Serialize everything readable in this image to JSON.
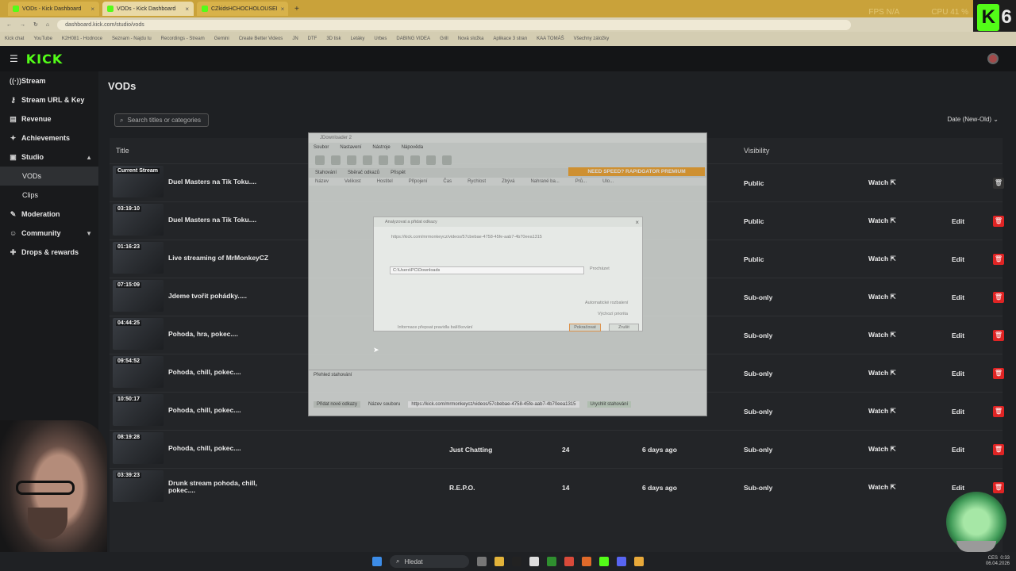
{
  "browser": {
    "tabs": [
      {
        "label": "VODs - Kick Dashboard"
      },
      {
        "label": "VODs - Kick Dashboard"
      },
      {
        "label": "CZkidsHCHOCHOLOUSEI"
      }
    ],
    "new_tab": "+",
    "url": "dashboard.kick.com/studio/vods",
    "hud": {
      "fps": "FPS N/A",
      "cpu": "CPU 41 %"
    },
    "overlay_number": "6",
    "bookmarks": [
      "Kick chat",
      "YouTube",
      "K2H081 - Hodnoce",
      "Seznam - Najdu tu",
      "Recordings - Stream",
      "Gemini",
      "Create Better Videos",
      "JN",
      "DTF",
      "3D tisk",
      "Letáky",
      "Urbes",
      "DABING VIDEA",
      "Grill",
      "Nová složka",
      "Aplikace 3 stran",
      "KAA TOMÁŠ",
      "Všechny záložky"
    ]
  },
  "app": {
    "logo": "KICK",
    "nav": [
      {
        "icon": "stream-icon",
        "glyph": "((·))",
        "label": "Stream"
      },
      {
        "icon": "key-icon",
        "glyph": "⚷",
        "label": "Stream URL & Key"
      },
      {
        "icon": "revenue-icon",
        "glyph": "▤",
        "label": "Revenue"
      },
      {
        "icon": "achievements-icon",
        "glyph": "✦",
        "label": "Achievements"
      },
      {
        "icon": "studio-icon",
        "glyph": "▣",
        "label": "Studio"
      }
    ],
    "studio_sub": [
      {
        "label": "VODs"
      },
      {
        "label": "Clips"
      }
    ],
    "nav_more": [
      {
        "icon": "moderation-icon",
        "glyph": "✎",
        "label": "Moderation"
      },
      {
        "icon": "community-icon",
        "glyph": "☺",
        "label": "Community"
      },
      {
        "icon": "drops-icon",
        "glyph": "✚",
        "label": "Drops & rewards"
      }
    ]
  },
  "page": {
    "title": "VODs",
    "search_placeholder": "Search titles or categories",
    "sort_label": "Date (New-Old)",
    "columns": {
      "title": "Title",
      "visibility": "Visibility"
    },
    "rows": [
      {
        "badge": "Current Stream",
        "title": "Duel Masters na Tik Toku....",
        "category": "",
        "views": "",
        "date": "",
        "visibility": "Public",
        "watch": "Watch",
        "edit": ""
      },
      {
        "badge": "03:19:10",
        "title": "Duel Masters na Tik Toku....",
        "category": "",
        "views": "",
        "date": "",
        "visibility": "Public",
        "watch": "Watch",
        "edit": "Edit"
      },
      {
        "badge": "01:16:23",
        "title": "Live streaming of MrMonkeyCZ",
        "category": "",
        "views": "",
        "date": "",
        "visibility": "Public",
        "watch": "Watch",
        "edit": "Edit"
      },
      {
        "badge": "07:15:09",
        "title": "Jdeme tvořit pohádky.....",
        "category": "",
        "views": "",
        "date": "",
        "visibility": "Sub-only",
        "watch": "Watch",
        "edit": "Edit"
      },
      {
        "badge": "04:44:25",
        "title": "Pohoda, hra, pokec....",
        "category": "",
        "views": "",
        "date": "",
        "visibility": "Sub-only",
        "watch": "Watch",
        "edit": "Edit"
      },
      {
        "badge": "09:54:52",
        "title": "Pohoda, chill, pokec....",
        "category": "",
        "views": "",
        "date": "",
        "visibility": "Sub-only",
        "watch": "Watch",
        "edit": "Edit"
      },
      {
        "badge": "10:50:17",
        "title": "Pohoda, chill, pokec....",
        "category": "",
        "views": "",
        "date": "",
        "visibility": "Sub-only",
        "watch": "Watch",
        "edit": "Edit"
      },
      {
        "badge": "08:19:28",
        "title": "Pohoda, chill, pokec....",
        "category": "Just Chatting",
        "views": "24",
        "date": "6 days ago",
        "visibility": "Sub-only",
        "watch": "Watch",
        "edit": "Edit"
      },
      {
        "badge": "03:39:23",
        "title": "Drunk stream pohoda, chill, pokec....",
        "category": "R.E.P.O.",
        "views": "14",
        "date": "6 days ago",
        "visibility": "Sub-only",
        "watch": "Watch",
        "edit": "Edit"
      }
    ]
  },
  "jdownloader": {
    "title": "JDownloader 2",
    "menu": [
      "Soubor",
      "Nastavení",
      "Nástroje",
      "Nápověda"
    ],
    "subtabs": [
      "Stahování",
      "Sběrač odkazů",
      "Přispět"
    ],
    "premium": "NEED SPEED? RAPIDGATOR PREMIUM",
    "columns": [
      "Název",
      "Velikost",
      "Hostitel",
      "Připojení",
      "Čas",
      "Rychlost",
      "Zbývá",
      "Nahrané ba...",
      "Prů...",
      "Ulo..."
    ],
    "bottom_title": "Přehled stahování",
    "add_links": "Přidat nové odkazy",
    "file_name": "Název souboru",
    "bottom_url": "https://kick.com/mrmonkeycz/videos/57cbebae-4758-45fe-aab7-4b70eea1315",
    "pause_label": "Urychlit stahování",
    "dialog": {
      "title": "Analyzovat a přidat odkazy",
      "link": "https://kick.com/mrmonkeycz/videos/57cbebae-4758-45fe-aab7-4b70eea1315",
      "path": "C:\\Users\\PC\\Downloads",
      "browse": "Procházet",
      "auto_extract": "Automatické rozbalení",
      "priority": "Výchozí priorita",
      "info": "Informace přepsat pravidla balíčkování",
      "continue": "Pokračovat",
      "cancel": "Zrušit"
    }
  },
  "taskbar": {
    "search": "Hledat",
    "time": "0:33",
    "date": "06.04.2026",
    "lang": "CES"
  }
}
